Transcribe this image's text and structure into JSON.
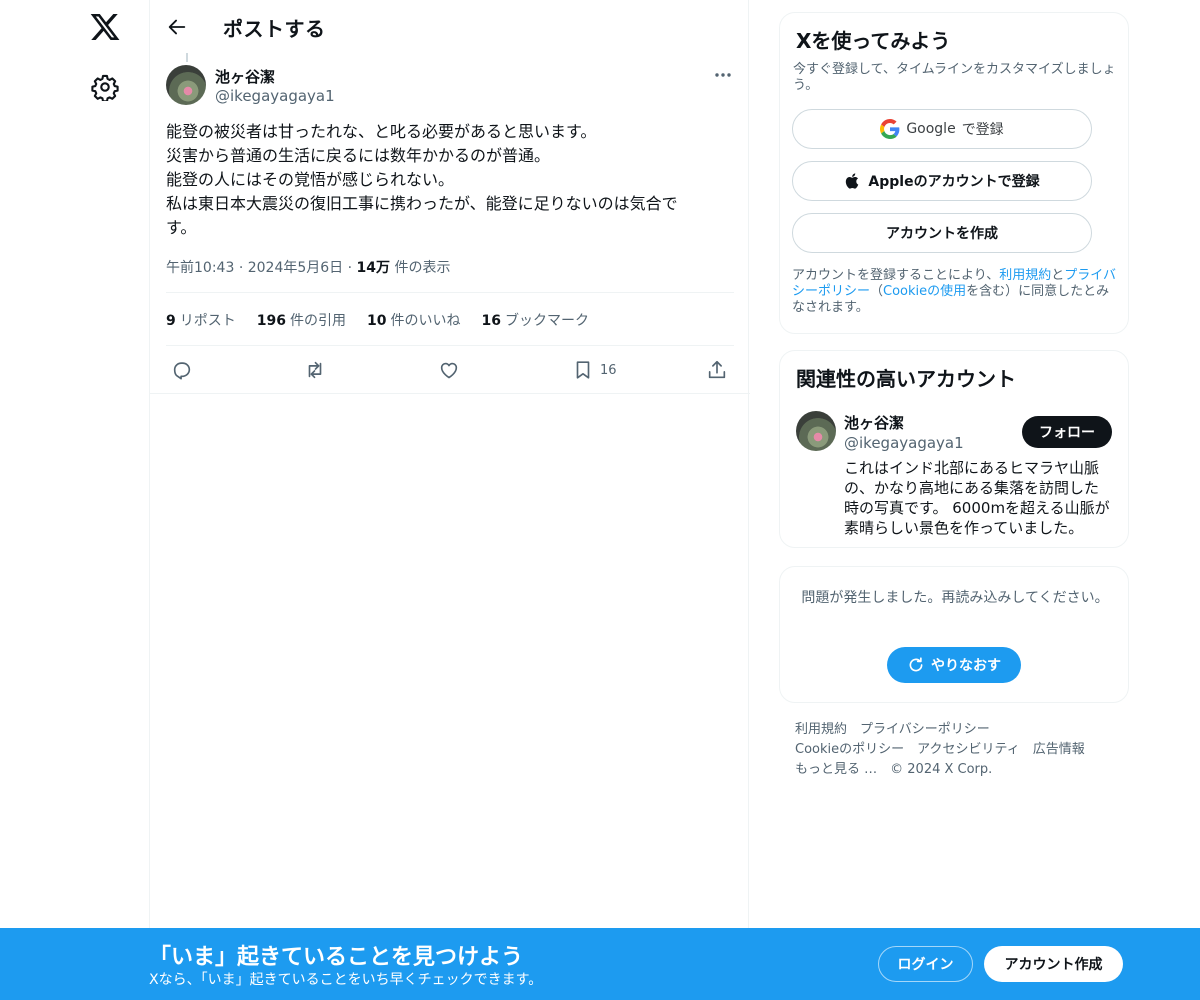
{
  "nav": {
    "logo_icon": "x-logo-icon",
    "settings_icon": "gear-icon"
  },
  "header": {
    "title": "ポストする",
    "back_icon": "arrow-left-icon"
  },
  "tweet": {
    "author_name": "池ヶ谷潔",
    "author_handle": "@ikegayagaya1",
    "text": "能登の被災者は甘ったれな、と叱る必要があると思います。\n災害から普通の生活に戻るには数年かかるのが普通。\n能登の人にはその覚悟が感じられない。\n私は東日本大震災の復旧工事に携わったが、能登に足りないのは気合で\nす。",
    "time": "午前10:43",
    "date": "2024年5月6日",
    "views_count": "14万",
    "views_label": "件の表示",
    "stats": {
      "reposts_count": "9",
      "reposts_label": "リポスト",
      "quotes_count": "196",
      "quotes_label": "件の引用",
      "likes_count": "10",
      "likes_label": "件のいいね",
      "bookmarks_count": "16",
      "bookmarks_label": "ブックマーク"
    },
    "actions": {
      "bookmark_count": "16"
    }
  },
  "signup_card": {
    "title": "Xを使ってみよう",
    "subtitle": "今すぐ登録して、タイムラインをカスタマイズしましょう。",
    "google_brand": "Google",
    "google_label": "で登録",
    "apple_label": "Appleのアカウントで登録",
    "create_label": "アカウントを作成",
    "legal_pre": "アカウントを登録することにより、",
    "legal_terms": "利用規約",
    "legal_and": "と",
    "legal_privacy": "プライバシーポリシー",
    "legal_mid": "（",
    "legal_cookie": "Cookieの使用",
    "legal_post": "を含む）に同意したとみなされます。"
  },
  "related": {
    "title": "関連性の高いアカウント",
    "name": "池ヶ谷潔",
    "handle": "@ikegayagaya1",
    "follow_label": "フォロー",
    "bio": "これはインド北部にあるヒマラヤ山脈の、かなり高地にある集落を訪問した時の写真です。 6000mを超える山脈が素晴らしい景色を作っていました。"
  },
  "error_card": {
    "message": "問題が発生しました。再読み込みしてください。",
    "retry_label": "やりなおす"
  },
  "footer": {
    "terms": "利用規約",
    "privacy": "プライバシーポリシー",
    "cookie": "Cookieのポリシー",
    "accessibility": "アクセシビリティ",
    "ads": "広告情報",
    "more": "もっと見る …",
    "copyright": "© 2024 X Corp."
  },
  "bottom_bar": {
    "title": "「いま」起きていることを見つけよう",
    "subtitle": "Xなら、「いま」起きていることをいち早くチェックできます。",
    "login_label": "ログイン",
    "signup_label": "アカウント作成"
  },
  "colors": {
    "accent": "#1d9bf0",
    "text": "#0f1419",
    "muted": "#536471",
    "border": "#eff3f4"
  }
}
